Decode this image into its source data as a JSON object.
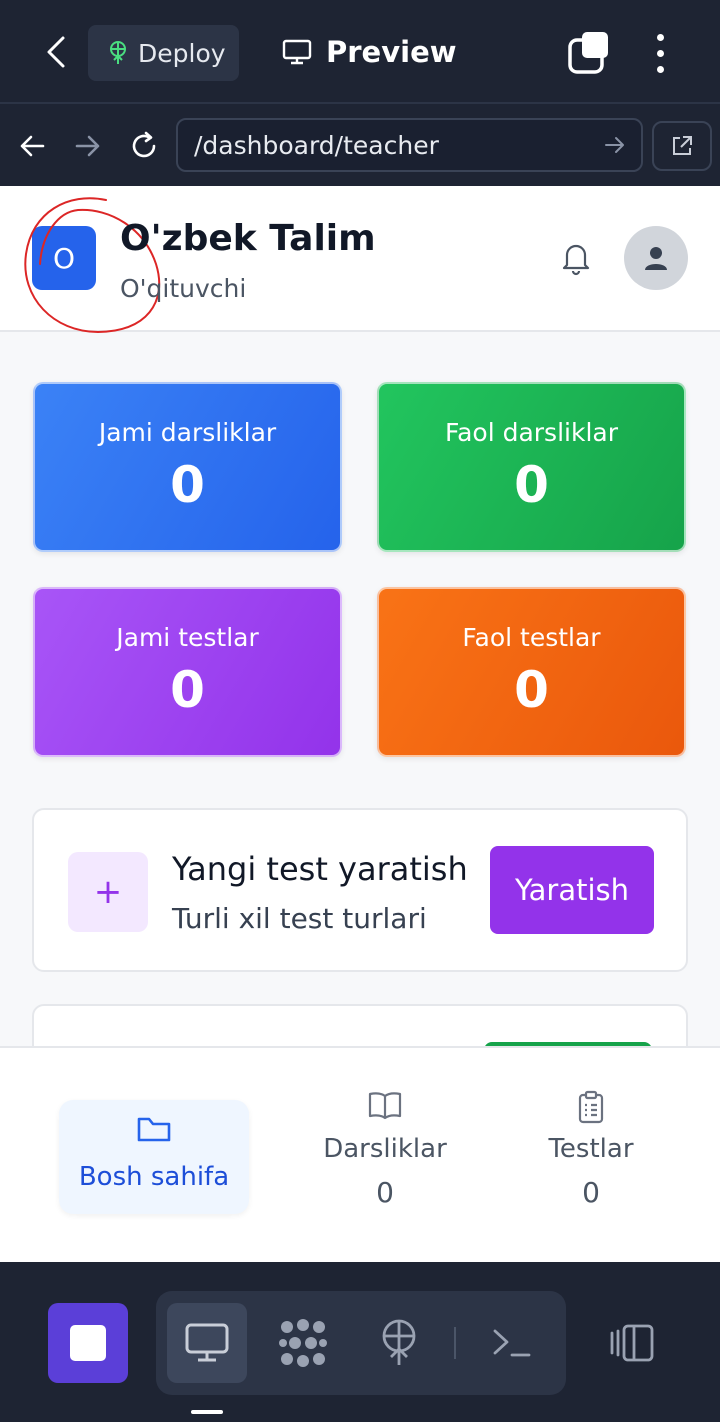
{
  "topbar": {
    "deploy_label": "Deploy",
    "preview_label": "Preview"
  },
  "urlbar": {
    "url": "/dashboard/teacher"
  },
  "app": {
    "logo_letter": "O",
    "title": "O'zbek Talim",
    "subtitle": "O'qituvchi",
    "stats": [
      {
        "label": "Jami darsliklar",
        "value": "0",
        "color": "#2563eb"
      },
      {
        "label": "Faol darsliklar",
        "value": "0",
        "color": "#16a34a"
      },
      {
        "label": "Jami testlar",
        "value": "0",
        "color": "#9333ea"
      },
      {
        "label": "Faol testlar",
        "value": "0",
        "color": "#ea580c"
      }
    ],
    "create_card": {
      "icon": "+",
      "title": "Yangi test yaratish",
      "subtitle": "Turli xil test turlari",
      "button_label": "Yaratish"
    },
    "nav": [
      {
        "label": "Bosh sahifa",
        "icon": "folder-icon"
      },
      {
        "label": "Darsliklar",
        "count": "0",
        "icon": "book-icon"
      },
      {
        "label": "Testlar",
        "count": "0",
        "icon": "clipboard-icon"
      }
    ]
  },
  "colors": {
    "accent_purple": "#9333ea",
    "annotation_red": "#dc2626"
  }
}
